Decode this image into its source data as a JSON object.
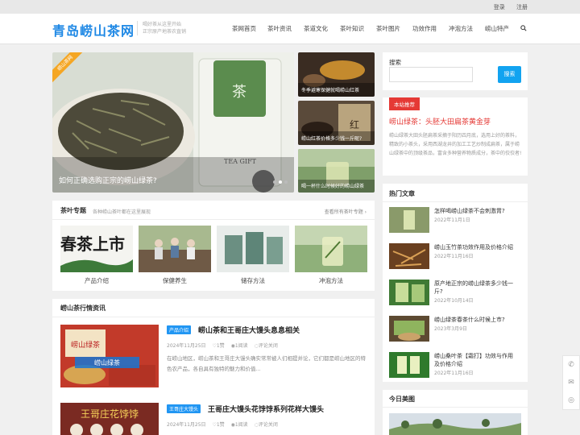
{
  "topbar": {
    "login": "登录",
    "register": "注册"
  },
  "header": {
    "logo": "青岛崂山茶网",
    "slogan_line1": "喝好茶从这里开始",
    "slogan_line2": "正宗原产地茶农直销"
  },
  "nav": [
    "茶网首页",
    "茶叶资讯",
    "茶道文化",
    "茶叶知识",
    "茶叶图片",
    "功效作用",
    "冲泡方法",
    "崂山特产"
  ],
  "slider": {
    "ribbon": "崂山茶网",
    "main_caption": "如何正确选购正宗的崂山绿茶?",
    "thumbs": [
      "冬季避寒保健就喝崂山红茶",
      "崂山红茶价格多少钱一斤呢?",
      "喝一杯什么时候好的崂山绿茶"
    ]
  },
  "topics": {
    "title": "茶叶专题",
    "subtitle": "各种崂山茶叶都在这里展现",
    "more": "查看所有茶叶专题 ›",
    "items": [
      "产品介绍",
      "保健养生",
      "储存方法",
      "冲泡方法"
    ]
  },
  "news": {
    "title": "崂山茶行情资讯",
    "items": [
      {
        "tag": "产品介绍",
        "title": "崂山茶和王哥庄大馒头息息相关",
        "date": "2024年11月25日",
        "likes": "1赞",
        "reads": "1阅读",
        "comments": "评论关闭",
        "excerpt": "在崂山地区，崂山茶和王哥庄大馒头确实常常被人们相提并论，它们都是崂山地区的特色农产品，各自具有独特的魅力和价值...",
        "img_text": "崂山绿茶"
      },
      {
        "tag": "王哥庄大馒头",
        "title": "王哥庄大馒头花饽饽系列花样大馒头",
        "date": "2024年11月25日",
        "likes": "1赞",
        "reads": "1阅读",
        "comments": "评论关闭",
        "img_text": "王哥庄花饽饽"
      }
    ]
  },
  "sidebar": {
    "search_label": "搜索",
    "search_placeholder": "",
    "search_button": "搜索",
    "recommend_badge": "本站推荐",
    "recommend_title": "崂山绿茶：头胚大田扁茶黄金芽",
    "recommend_text": "崂山绿茶大田头胚扁茶采摘于阳历四月底，选用上好的茶料，精致的小茶头，采用西湖龙井的加工工艺炒制成扁茶，属于崂山绿茶中的顶级茶品，富含多种营养物质成分，茶中的佼佼者!",
    "hot_title": "热门文章",
    "hot": [
      {
        "title": "怎样喝崂山绿茶不会刺激胃?",
        "date": "2022年11月1日"
      },
      {
        "title": "崂山玉竹茶功效作用及价格介绍",
        "date": "2022年11月16日"
      },
      {
        "title": "原产地正宗的崂山绿茶多少钱一斤?",
        "date": "2022年10月14日"
      },
      {
        "title": "崂山绿茶春茶什么时候上市?",
        "date": "2023年3月9日"
      },
      {
        "title": "崂山桑叶茶【霜打】功效与作用及价格介绍",
        "date": "2022年11月16日"
      }
    ],
    "today_title": "今日美图"
  },
  "float": [
    "✆",
    "✉",
    "◎"
  ],
  "colors": {
    "accent": "#1e88e5",
    "badge": "#e53935",
    "tag": "#2196f3"
  }
}
